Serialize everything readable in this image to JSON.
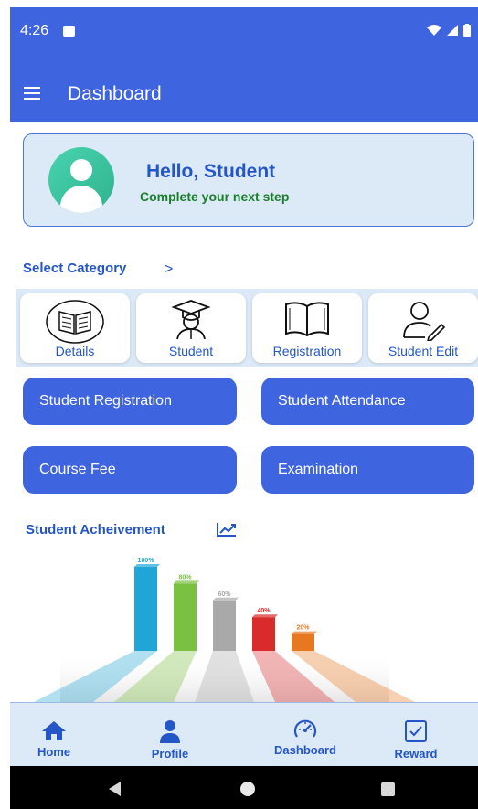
{
  "status_bar": {
    "time": "4:26"
  },
  "app_bar": {
    "title": "Dashboard"
  },
  "greeting": {
    "title": "Hello, Student",
    "subtitle": "Complete your next step"
  },
  "category": {
    "title": "Select Category",
    "arrow": ">",
    "items": [
      {
        "label": "Details",
        "icon": "book-reading-icon"
      },
      {
        "label": "Student",
        "icon": "graduate-icon"
      },
      {
        "label": "Registration",
        "icon": "open-book-icon"
      },
      {
        "label": "Student Edit",
        "icon": "user-edit-icon"
      }
    ]
  },
  "actions": [
    {
      "label": "Student Registration"
    },
    {
      "label": "Student Attendance"
    },
    {
      "label": "Course Fee"
    },
    {
      "label": "Examination"
    }
  ],
  "achievement": {
    "title": "Student Acheivement",
    "chart_data": {
      "type": "bar",
      "categories": [
        "",
        "",
        "",
        "",
        ""
      ],
      "values": [
        100,
        80,
        60,
        40,
        20
      ],
      "data_labels": [
        "100%",
        "80%",
        "60%",
        "40%",
        "20%"
      ],
      "colors": [
        "#1FA6D6",
        "#7AC142",
        "#A9A9A9",
        "#D92B2B",
        "#E87722"
      ],
      "title": "",
      "xlabel": "",
      "ylabel": "",
      "ylim": [
        0,
        100
      ]
    }
  },
  "bottom_nav": [
    {
      "label": "Home",
      "icon": "home-icon"
    },
    {
      "label": "Profile",
      "icon": "person-icon"
    },
    {
      "label": "Dashboard",
      "icon": "speedometer-icon"
    },
    {
      "label": "Reward",
      "icon": "checkbox-icon"
    }
  ],
  "colors": {
    "primary": "#3F64E0",
    "accent_text": "#2456C8",
    "card_bg": "#DCE9F7",
    "success_text": "#1A7F2A"
  }
}
